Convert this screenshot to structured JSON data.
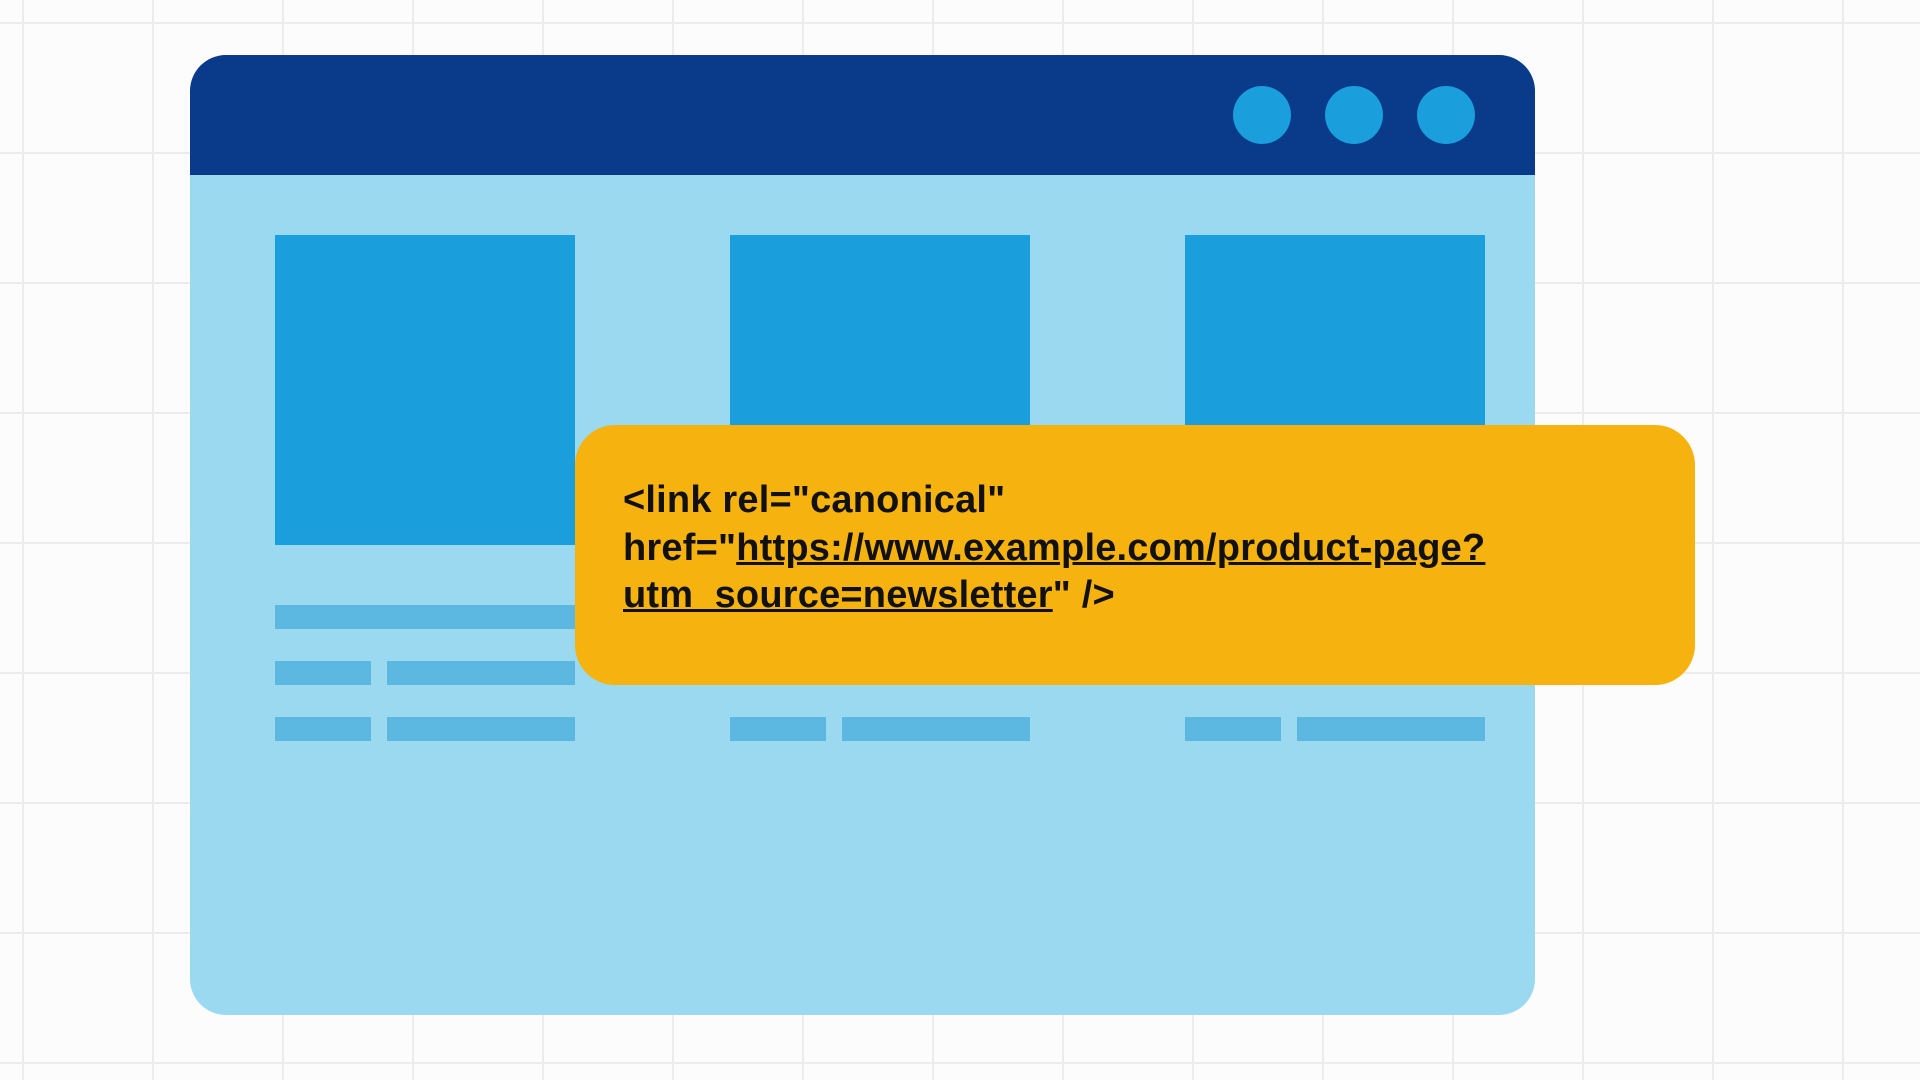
{
  "callout": {
    "prefix": "<link rel=\"canonical\" href=\"",
    "url": "https://www.example.com/product-page?utm_source=newsletter",
    "suffix": "\" />"
  },
  "colors": {
    "grid_line": "#ececec",
    "page_bg": "#fcfcfc",
    "titlebar": "#0a3a8a",
    "window_body": "#9ad9ef",
    "accent_blue": "#1a9edc",
    "placeholder_bar": "#5cb8e0",
    "callout_bg": "#f6b20e"
  }
}
